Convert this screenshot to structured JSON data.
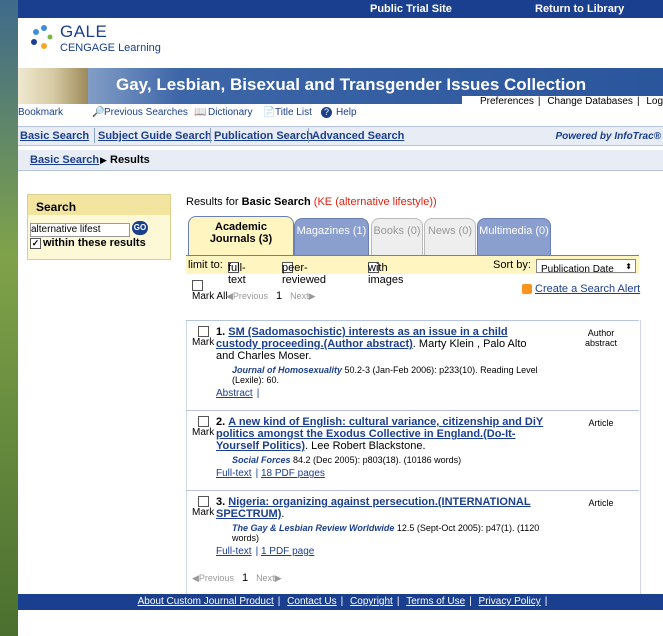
{
  "top": {
    "public_trial": "Public Trial Site",
    "return": "Return to Library"
  },
  "logo": {
    "line1": "GALE",
    "line2": "CENGAGE Learning"
  },
  "banner": {
    "title": "Gay, Lesbian, Bisexual and Transgender Issues Collection"
  },
  "prefs": {
    "preferences": "Preferences",
    "change_db": "Change Databases",
    "logout": "Logout"
  },
  "toolbar": {
    "bookmark": "Bookmark",
    "previous_searches": "Previous Searches",
    "dictionary": "Dictionary",
    "title_list": "Title List",
    "help": "Help"
  },
  "nav": {
    "basic": "Basic Search",
    "subject": "Subject Guide Search",
    "publication": "Publication Search",
    "advanced": "Advanced Search",
    "powered": "Powered by InfoTrac®"
  },
  "breadcrumb": {
    "basic": "Basic Search",
    "arrow": "▶",
    "results": "Results"
  },
  "search": {
    "heading": "Search",
    "value": "alternative lifest",
    "go": "GO",
    "within": "within these results"
  },
  "results_for": {
    "prefix": "Results for ",
    "type": "Basic Search",
    "query": " (KE (alternative lifestyle))"
  },
  "tabs": [
    {
      "label": "Academic Journals (3)"
    },
    {
      "label": "Magazines (1)"
    },
    {
      "label": "Books (0)"
    },
    {
      "label": "News (0)"
    },
    {
      "label": "Multimedia (0)"
    }
  ],
  "limit": {
    "prefix": "limit to:",
    "fulltext": "full-text",
    "peer": "peer-reviewed",
    "images": "with images",
    "sort_label": "Sort by:",
    "sort_value": "Publication Date"
  },
  "pager": {
    "mark_all": "Mark All",
    "previous": "Previous",
    "page": "1",
    "next": "Next"
  },
  "alert": "Create a Search Alert",
  "results": [
    {
      "num": "1.",
      "title": "SM (Sadomasochistic) interests as an issue in a child custody proceeding.(Author abstract)",
      "authors": ". Marty Klein , Palo Alto  and Charles Moser.",
      "journal": "Journal of Homosexuality",
      "details": " 50.2-3 (Jan-Feb 2006): p233(10).  Reading Level (Lexile): 60.",
      "links": [
        "Abstract"
      ],
      "type": "Author abstract"
    },
    {
      "num": "2.",
      "title": "A new kind of English: cultural variance, citizenship and DiY politics amongst the Exodus Collective in England.(Do-It-Yourself Politics)",
      "authors": ". Lee Robert Blackstone.",
      "journal": "Social Forces",
      "details": " 84.2 (Dec 2005): p803(18). (10186 words)",
      "links": [
        "Full-text",
        "18 PDF pages"
      ],
      "type": "Article"
    },
    {
      "num": "3.",
      "title": "Nigeria: organizing against persecution.(INTERNATIONAL SPECTRUM)",
      "authors": ".",
      "journal": "The Gay & Lesbian Review Worldwide",
      "details": " 12.5 (Sept-Oct 2005): p47(1). (1120 words)",
      "links": [
        "Full-text",
        "1 PDF page"
      ],
      "type": "Article"
    }
  ],
  "mark_label": "Mark",
  "footer": {
    "about": "About Custom Journal Product",
    "contact": "Contact Us",
    "copyright": "Copyright",
    "terms": "Terms of Use",
    "privacy": "Privacy Policy"
  }
}
